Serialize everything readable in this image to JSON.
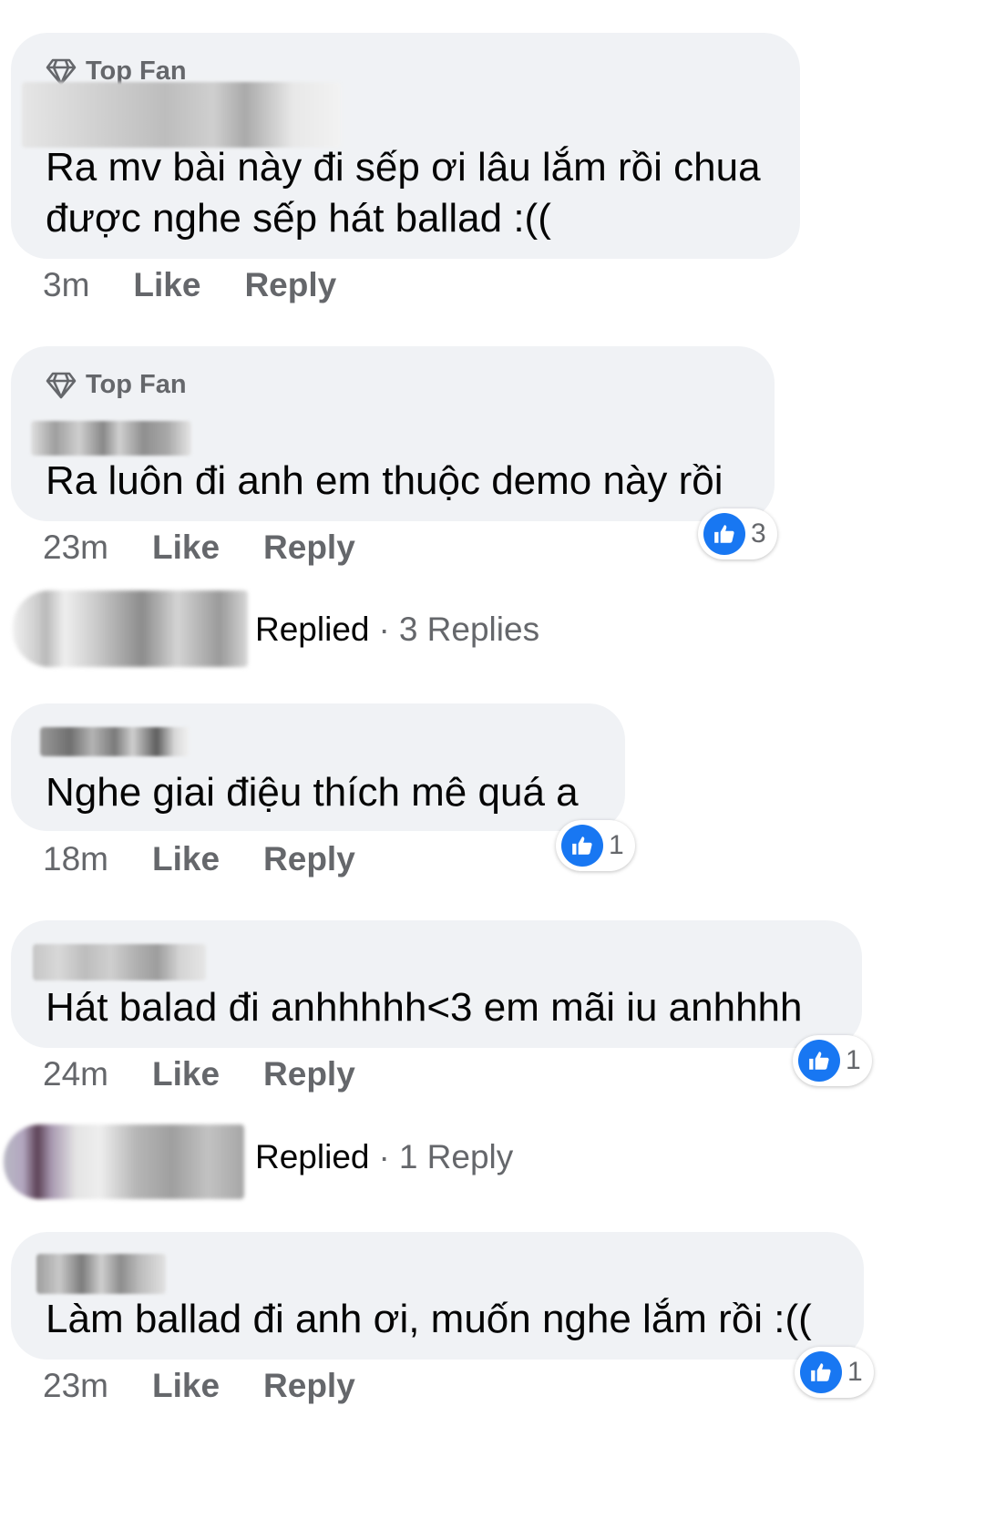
{
  "labels": {
    "top_fan": "Top Fan",
    "like": "Like",
    "reply": "Reply",
    "replied": "Replied",
    "separator": "·"
  },
  "comments": [
    {
      "badge": "Top Fan",
      "text_lines": [
        "Ra mv bài này đi sếp ơi lâu lắm rồi chua",
        "được nghe sếp hát ballad :(("
      ],
      "time": "3m",
      "reactions": null
    },
    {
      "badge": "Top Fan",
      "text_lines": [
        "Ra luôn đi anh em thuộc demo này rồi"
      ],
      "time": "23m",
      "reactions": "3"
    },
    {
      "badge": null,
      "text_lines": [
        "Nghe giai điệu thích mê quá a"
      ],
      "time": "18m",
      "reactions": "1"
    },
    {
      "badge": null,
      "text_lines": [
        "Hát balad đi anhhhhh<3 em mãi iu anhhhh"
      ],
      "time": "24m",
      "reactions": "1"
    },
    {
      "badge": null,
      "text_lines": [
        "Làm ballad đi anh ơi, muốn nghe lắm rồi :(("
      ],
      "time": "23m",
      "reactions": "1"
    }
  ],
  "reply_summaries": [
    {
      "label": "Replied",
      "count": "3 Replies"
    },
    {
      "label": "Replied",
      "count": "1 Reply"
    }
  ],
  "icons": {
    "badge": "diamond-icon",
    "reaction": "thumbs-up-icon"
  },
  "colors": {
    "bubble": "#f0f2f5",
    "like_blue": "#1877f2",
    "secondary_text": "#65676b"
  }
}
